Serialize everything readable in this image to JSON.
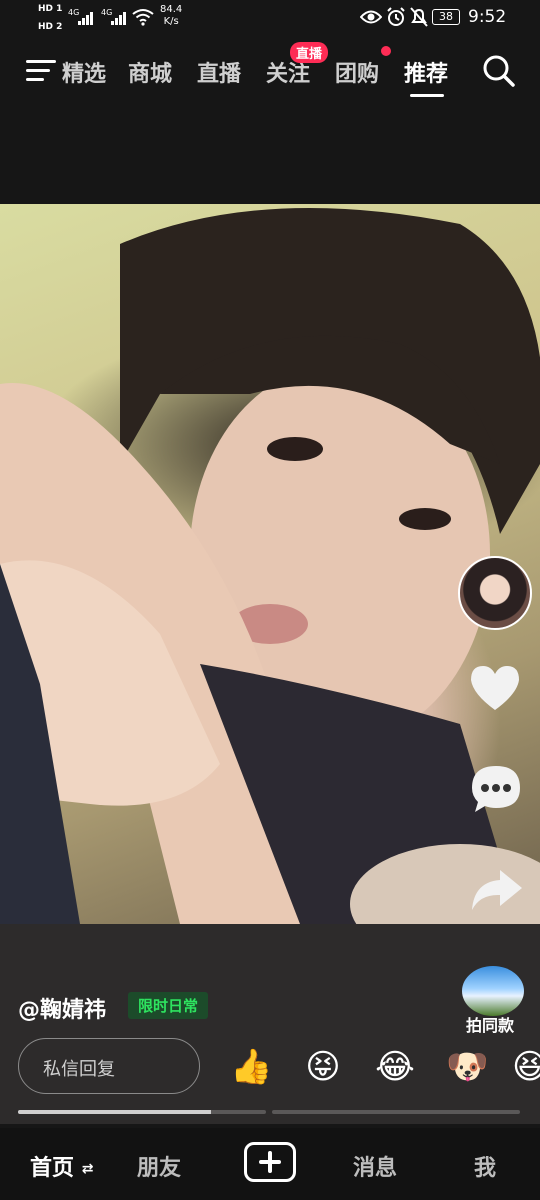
{
  "status_bar": {
    "sim1": "HD 1",
    "sim2": "HD 2",
    "net1": "4G",
    "net2": "4G",
    "speed_value": "84.4",
    "speed_unit": "K/s",
    "battery": "38",
    "time": "9:52"
  },
  "top_nav": {
    "tabs": [
      "精选",
      "商城",
      "直播",
      "关注",
      "团购",
      "推荐"
    ],
    "active_tab": "推荐",
    "follow_badge": "直播"
  },
  "post": {
    "username": "@鞠婧祎",
    "tag": "限时日常",
    "same_style_label": "拍同款",
    "reply_placeholder": "私信回复",
    "emojis": [
      "👍",
      "😝",
      "😂",
      "🐶",
      "😆"
    ],
    "progress_first_segment": 0.78
  },
  "icons": {
    "menu": "menu-icon",
    "search": "search-icon",
    "like": "heart-icon",
    "comment": "comment-icon",
    "share": "share-icon",
    "plus": "plus-icon",
    "switch": "switch-arrows-icon"
  },
  "bottom_nav": {
    "home": "首页",
    "friends": "朋友",
    "messages": "消息",
    "me": "我"
  },
  "colors": {
    "accent_red": "#fe2c55",
    "tag_green": "#2ee35f"
  }
}
